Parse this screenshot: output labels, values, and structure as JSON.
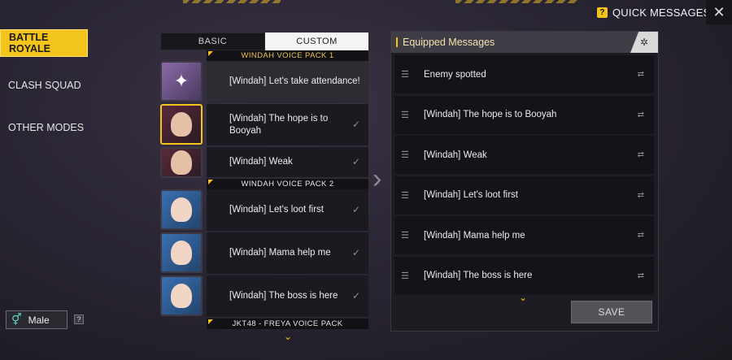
{
  "header": {
    "title": "QUICK MESSAGES",
    "help_badge": "?",
    "close_glyph": "✕"
  },
  "modes": [
    {
      "label": "BATTLE ROYALE",
      "active": true
    },
    {
      "label": "CLASH SQUAD",
      "active": false
    },
    {
      "label": "OTHER MODES",
      "active": false
    }
  ],
  "gender": {
    "icon": "gender-swap-icon",
    "value": "Male",
    "help": "?"
  },
  "tabs": {
    "basic": "BASIC",
    "custom": "CUSTOM"
  },
  "packs": {
    "pack1_title": "WINDAH VOICE PACK 1",
    "pack2_title": "WINDAH VOICE PACK 2",
    "pack3_title": "JKT48 - FREYA VOICE PACK"
  },
  "messages": [
    {
      "text": "[Windah] Let's take attendance!",
      "equipped": false
    },
    {
      "text": "[Windah] The hope is to Booyah",
      "equipped": true
    },
    {
      "text": "[Windah] Weak",
      "equipped": true
    },
    {
      "text": "[Windah] Let's loot first",
      "equipped": true
    },
    {
      "text": "[Windah] Mama help me",
      "equipped": true
    },
    {
      "text": "[Windah] The boss is here",
      "equipped": true
    }
  ],
  "equipped": {
    "title": "Equipped Messages",
    "items": [
      "Enemy spotted",
      "[Windah] The hope is to Booyah",
      "[Windah] Weak",
      "[Windah] Let's loot first",
      "[Windah] Mama help me",
      "[Windah] The boss is here"
    ],
    "save_label": "SAVE"
  },
  "glyphs": {
    "check": "✓",
    "drag": "☰",
    "swap": "⇄",
    "chevron": "⌄",
    "arrow": "›"
  },
  "colors": {
    "accent": "#f3c41a",
    "panel": "#1d1c22"
  }
}
